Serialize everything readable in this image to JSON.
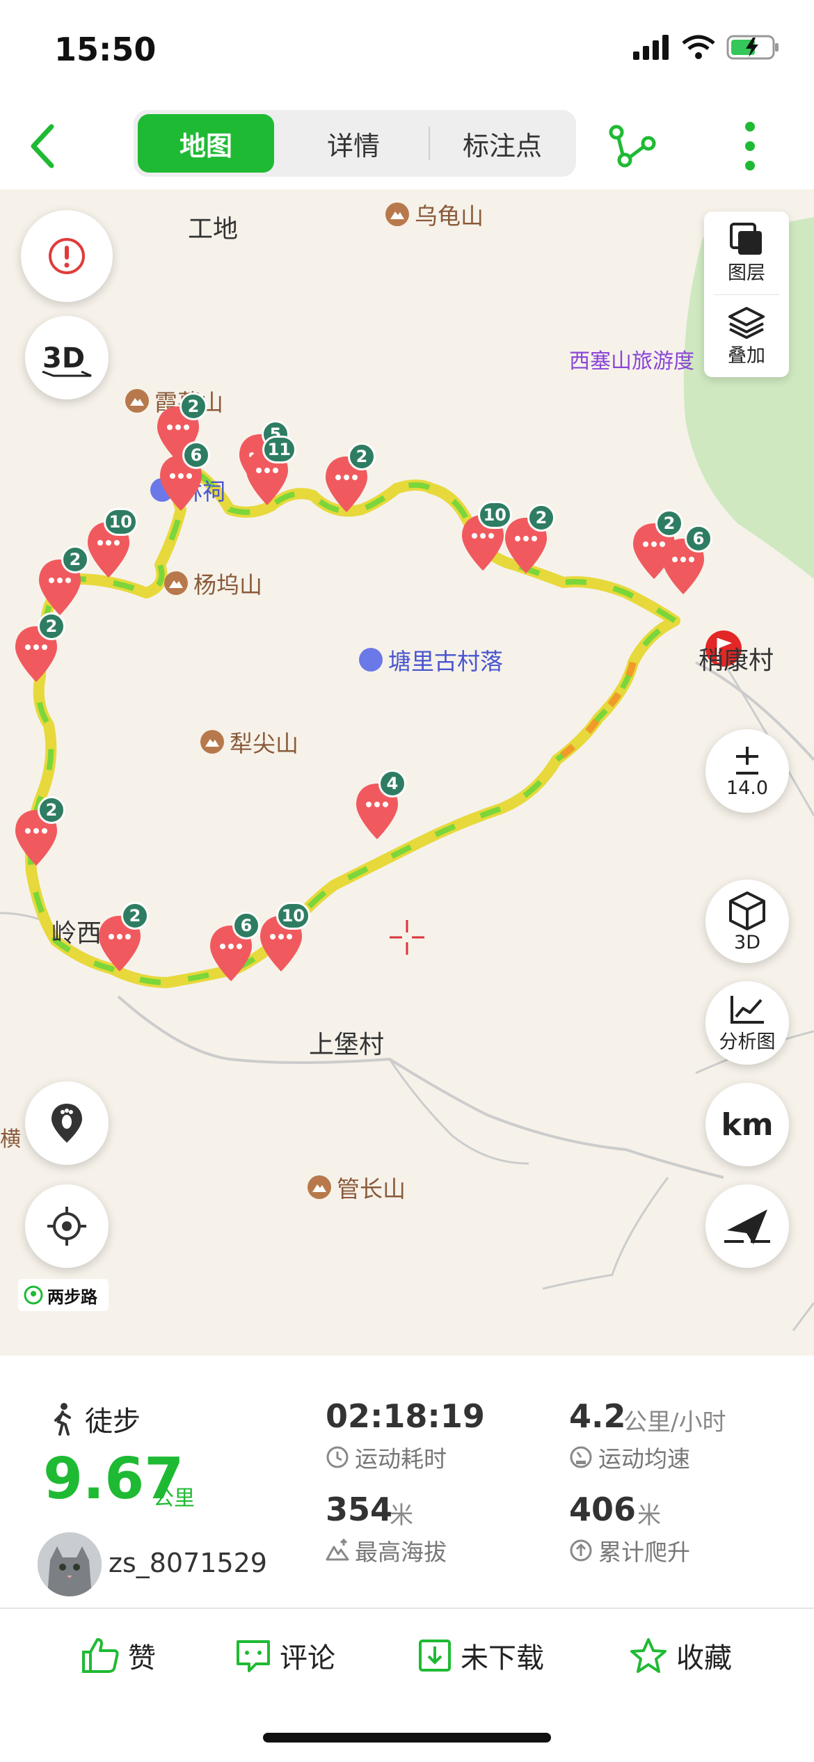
{
  "status_bar": {
    "time": "15:50"
  },
  "nav": {
    "tabs": [
      {
        "label": "地图",
        "active": true
      },
      {
        "label": "详情",
        "active": false
      },
      {
        "label": "标注点",
        "active": false
      }
    ]
  },
  "map": {
    "labels": {
      "gongdi": "工地",
      "wuguishan": "乌龟山",
      "xiamushan": "霞幕山",
      "linci": "林祠",
      "yangwushan": "杨坞山",
      "tangli": "塘里古村落",
      "lijianshan": "犁尖山",
      "shaokangcun": "稍康村",
      "lingxi": "岭西",
      "shangbaocun": "上堡村",
      "guanchangshan": "管长山",
      "heng": "横",
      "xisaishan": "西塞山旅游度"
    },
    "controls": {
      "layers": "图层",
      "overlay": "叠加",
      "zoom_level": "14.0",
      "threed": "3D",
      "analysis": "分析图",
      "km": "km"
    },
    "brand": "两步路",
    "markers": [
      "2",
      "6",
      "5",
      "11",
      "2",
      "10",
      "10",
      "2",
      "2",
      "6",
      "2",
      "2",
      "2",
      "4",
      "10",
      "6",
      "2"
    ]
  },
  "stats": {
    "activity": "徒步",
    "distance": "9.67",
    "distance_unit": "公里",
    "username": "zs_8071529",
    "duration": "02:18:19",
    "duration_label": "运动耗时",
    "speed": "4.2",
    "speed_unit": "公里/小时",
    "speed_label": "运动均速",
    "max_alt": "354",
    "max_alt_unit": "米",
    "max_alt_label": "最高海拔",
    "ascent": "406",
    "ascent_unit": "米",
    "ascent_label": "累计爬升"
  },
  "actions": {
    "like": "赞",
    "comment": "评论",
    "download": "未下载",
    "favorite": "收藏"
  },
  "colors": {
    "accent": "#1fba33",
    "pin": "#f05a5e",
    "badge": "#2e7d63"
  }
}
